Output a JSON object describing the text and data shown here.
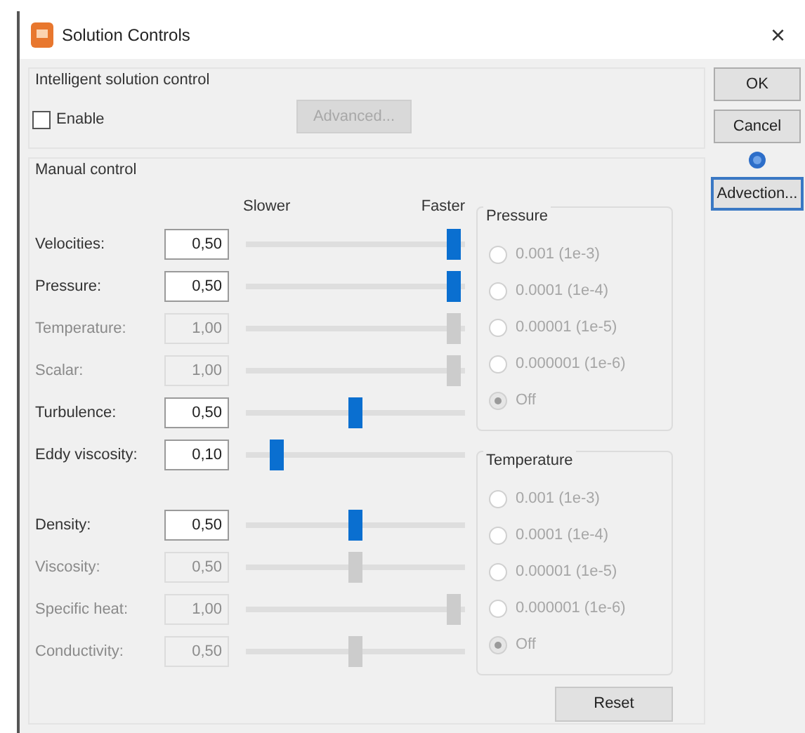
{
  "window": {
    "title": "Solution Controls",
    "close": "×"
  },
  "intelligent": {
    "title": "Intelligent solution control",
    "enable": {
      "label": "Enable",
      "checked": false
    },
    "advanced": {
      "label": "Advanced...",
      "disabled": true
    }
  },
  "manual": {
    "title": "Manual control",
    "slower": "Slower",
    "faster": "Faster",
    "solver_rows": [
      {
        "label": "Velocities:",
        "value": "0,50",
        "level": 1,
        "disabled": false
      },
      {
        "label": "Pressure:",
        "value": "0,50",
        "level": 1,
        "disabled": false
      },
      {
        "label": "Temperature:",
        "value": "1,00",
        "level": 1,
        "disabled": true
      },
      {
        "label": "Scalar:",
        "value": "1,00",
        "level": 1,
        "disabled": true
      },
      {
        "label": "Turbulence:",
        "value": "0,50",
        "level": 0.5,
        "disabled": false
      },
      {
        "label": "Eddy viscosity:",
        "value": "0,10",
        "level": 0.1,
        "disabled": false
      }
    ],
    "material_rows": [
      {
        "label": "Density:",
        "value": "0,50",
        "level": 0.5,
        "disabled": false
      },
      {
        "label": "Viscosity:",
        "value": "0,50",
        "level": 0.5,
        "disabled": true
      },
      {
        "label": "Specific heat:",
        "value": "1,00",
        "level": 1,
        "disabled": true
      },
      {
        "label": "Conductivity:",
        "value": "0,50",
        "level": 0.5,
        "disabled": true
      }
    ],
    "radio_groups": [
      {
        "title": "Pressure",
        "disabled": true,
        "options": [
          {
            "label": "0.001 (1e-3)",
            "selected": false
          },
          {
            "label": "0.0001 (1e-4)",
            "selected": false
          },
          {
            "label": "0.00001 (1e-5)",
            "selected": false
          },
          {
            "label": "0.000001 (1e-6)",
            "selected": false
          },
          {
            "label": "Off",
            "selected": true
          }
        ]
      },
      {
        "title": "Temperature",
        "disabled": true,
        "options": [
          {
            "label": "0.001 (1e-3)",
            "selected": false
          },
          {
            "label": "0.0001 (1e-4)",
            "selected": false
          },
          {
            "label": "0.00001 (1e-5)",
            "selected": false
          },
          {
            "label": "0.000001 (1e-6)",
            "selected": false
          },
          {
            "label": "Off",
            "selected": true
          }
        ]
      }
    ],
    "reset": "Reset"
  },
  "buttons": {
    "ok": "OK",
    "cancel": "Cancel",
    "advection": "Advection..."
  }
}
